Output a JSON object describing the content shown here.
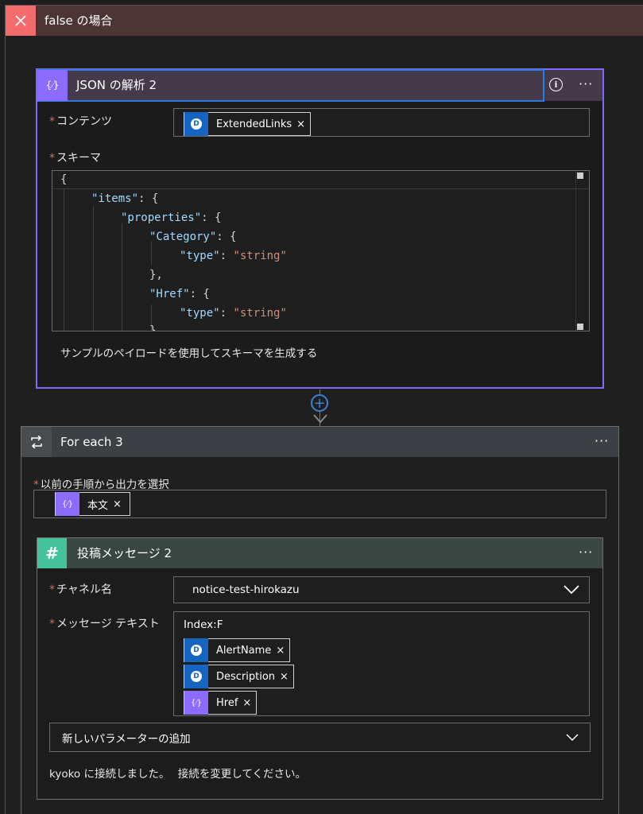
{
  "branch": {
    "title": "false の場合"
  },
  "parse_json": {
    "title": "JSON の解析 2",
    "content_label": "コンテンツ",
    "content_token": "ExtendedLinks",
    "schema_label": "スキーマ",
    "code": {
      "l1": "{",
      "items_key": "\"items\"",
      "properties_key": "\"properties\"",
      "category_key": "\"Category\"",
      "type_key_1": "\"type\"",
      "string_val_1": "\"string\"",
      "close_brace": "},",
      "href_key": "\"Href\"",
      "type_key_2": "\"type\"",
      "string_val_2": "\"string\"",
      "open_brace": ": {",
      "colon": ": ",
      "partial": "}"
    },
    "generate_link": "サンプルのペイロードを使用してスキーマを生成する"
  },
  "for_each": {
    "title": "For each 3",
    "select_label": "以前の手順から出力を選択",
    "select_token": "本文"
  },
  "slack": {
    "title": "投稿メッセージ 2",
    "channel_label": "チャネル名",
    "channel_value": "notice-test-hirokazu",
    "message_label": "メッセージ テキスト",
    "message_text": "Index:F",
    "tokens": [
      "AlertName",
      "Description",
      "Href"
    ],
    "add_param": "新しいパラメーターの追加",
    "connection_text": "kyoko に接続しました。",
    "change_connection": "接続を変更してください。"
  },
  "icons": {
    "close": "×",
    "more": "···",
    "info": "i",
    "plus": "+",
    "chevron": "chevron-down",
    "required": "*"
  },
  "colors": {
    "accent": "#7d6aff",
    "required": "#e36464",
    "link_blue": "#2d7be0",
    "slack_green": "#43c29c",
    "branch_red": "#f36b6b"
  }
}
